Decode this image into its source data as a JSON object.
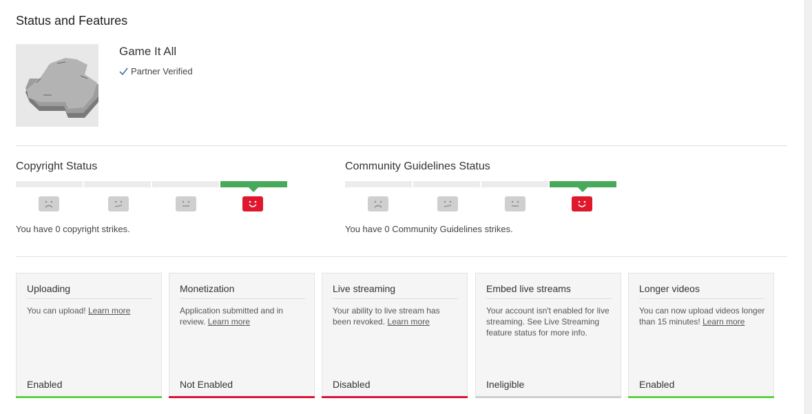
{
  "page": {
    "title": "Status and Features"
  },
  "channel": {
    "name": "Game It All",
    "verified_label": "Partner Verified",
    "verified_icon": "checkmark-icon"
  },
  "copyright": {
    "title": "Copyright Status",
    "strikes_text": "You have 0 copyright strikes.",
    "strike_count": 0,
    "faces": [
      "sad-face-icon",
      "unhappy-face-icon",
      "neutral-face-icon",
      "happy-face-icon"
    ],
    "active_index": 3
  },
  "community": {
    "title": "Community Guidelines Status",
    "strikes_text": "You have 0 Community Guidelines strikes.",
    "strike_count": 0,
    "faces": [
      "sad-face-icon",
      "unhappy-face-icon",
      "neutral-face-icon",
      "happy-face-icon"
    ],
    "active_index": 3
  },
  "colors": {
    "enabled": "#5fd33f",
    "not_enabled": "#d9163a",
    "disabled": "#d9163a",
    "ineligible": "#cfcfcf",
    "active_green": "#47a95a",
    "active_face": "#e0182d"
  },
  "features": [
    {
      "title": "Uploading",
      "desc": "You can upload!",
      "link": "Learn more",
      "status": "Enabled",
      "color": "#5fd33f"
    },
    {
      "title": "Monetization",
      "desc": "Application submitted and in review.",
      "link": "Learn more",
      "status": "Not Enabled",
      "color": "#d9163a"
    },
    {
      "title": "Live streaming",
      "desc": "Your ability to live stream has been revoked.",
      "link": "Learn more",
      "status": "Disabled",
      "color": "#d9163a"
    },
    {
      "title": "Embed live streams",
      "desc": "Your account isn't enabled for live streaming. See Live Streaming feature status for more info.",
      "link": "",
      "status": "Ineligible",
      "color": "#cfcfcf"
    },
    {
      "title": "Longer videos",
      "desc": "You can now upload videos longer than 15 minutes!",
      "link": "Learn more",
      "status": "Enabled",
      "color": "#5fd33f"
    }
  ]
}
